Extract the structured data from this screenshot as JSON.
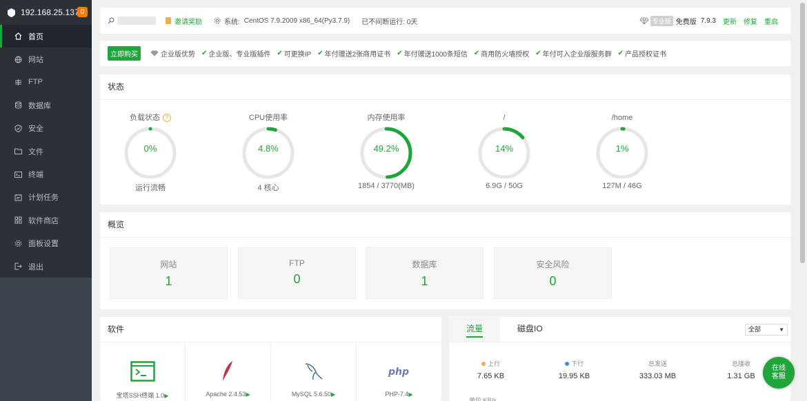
{
  "sidebar": {
    "ip": "192.168.25.137",
    "badge": "0",
    "items": [
      {
        "label": "首页",
        "icon": "home-icon"
      },
      {
        "label": "网站",
        "icon": "globe-icon"
      },
      {
        "label": "FTP",
        "icon": "ftp-icon"
      },
      {
        "label": "数据库",
        "icon": "database-icon"
      },
      {
        "label": "安全",
        "icon": "shield-icon"
      },
      {
        "label": "文件",
        "icon": "folder-icon"
      },
      {
        "label": "终端",
        "icon": "terminal-icon"
      },
      {
        "label": "计划任务",
        "icon": "calendar-icon"
      },
      {
        "label": "软件商店",
        "icon": "grid-icon"
      },
      {
        "label": "面板设置",
        "icon": "gear-icon"
      },
      {
        "label": "退出",
        "icon": "logout-icon"
      }
    ]
  },
  "topbar": {
    "invite": "邀请奖励",
    "sys_label": "系统:",
    "sys_value": "CentOS 7.9.2009 x86_64(Py3.7.9)",
    "uptime": "已不间断运行: 0天",
    "pro_tag": "专业版",
    "edition": "免费版",
    "version": "7.9.3",
    "update": "更新",
    "repair": "修复",
    "restart": "重启"
  },
  "promo": {
    "buy": "立即购买",
    "advantage": "企业版优势",
    "features": [
      "企业版、专业版插件",
      "可更换IP",
      "年付赠送2张商用证书",
      "年付赠送1000条短信",
      "商用防火墙授权",
      "年付可入企业版服务群",
      "产品授权证书"
    ]
  },
  "status": {
    "title": "状态",
    "gauges": [
      {
        "title": "负载状态",
        "value": "0%",
        "percent": 0,
        "sub": "运行流畅",
        "help": "?"
      },
      {
        "title": "CPU使用率",
        "value": "4.8%",
        "percent": 4.8,
        "sub": "4 核心"
      },
      {
        "title": "内存使用率",
        "value": "49.2%",
        "percent": 49.2,
        "sub": "1854 / 3770(MB)"
      },
      {
        "title": "/",
        "value": "14%",
        "percent": 14,
        "sub": "6.9G / 50G"
      },
      {
        "title": "/home",
        "value": "1%",
        "percent": 1,
        "sub": "127M / 46G"
      }
    ]
  },
  "overview": {
    "title": "概览",
    "items": [
      {
        "label": "网站",
        "value": "1"
      },
      {
        "label": "FTP",
        "value": "0"
      },
      {
        "label": "数据库",
        "value": "1"
      },
      {
        "label": "安全风险",
        "value": "0"
      }
    ]
  },
  "software": {
    "title": "软件",
    "items": [
      {
        "name": "宝塔SSH终端 1.0",
        "icon": "terminal-app-icon"
      },
      {
        "name": "Apache 2.4.53",
        "icon": "apache-feather-icon"
      },
      {
        "name": "MySQL 5.6.50",
        "icon": "mysql-dolphin-icon"
      },
      {
        "name": "PHP-7.4",
        "icon": "php-icon"
      }
    ]
  },
  "traffic": {
    "tabs": [
      "流量",
      "磁盘IO"
    ],
    "select": "全部",
    "stats": [
      {
        "label": "上行",
        "value": "7.65 KB",
        "dot": "#f0ad4e"
      },
      {
        "label": "下行",
        "value": "19.95 KB",
        "dot": "#3a8ee6"
      },
      {
        "label": "总发送",
        "value": "333.03 MB"
      },
      {
        "label": "总接收",
        "value": "1.31 GB"
      }
    ],
    "unit": "单位:KB/s"
  },
  "online": {
    "line1": "在线",
    "line2": "客服"
  },
  "colors": {
    "accent": "#20a53a",
    "sidebar": "#3c444d",
    "warning": "#f0ad4e"
  }
}
